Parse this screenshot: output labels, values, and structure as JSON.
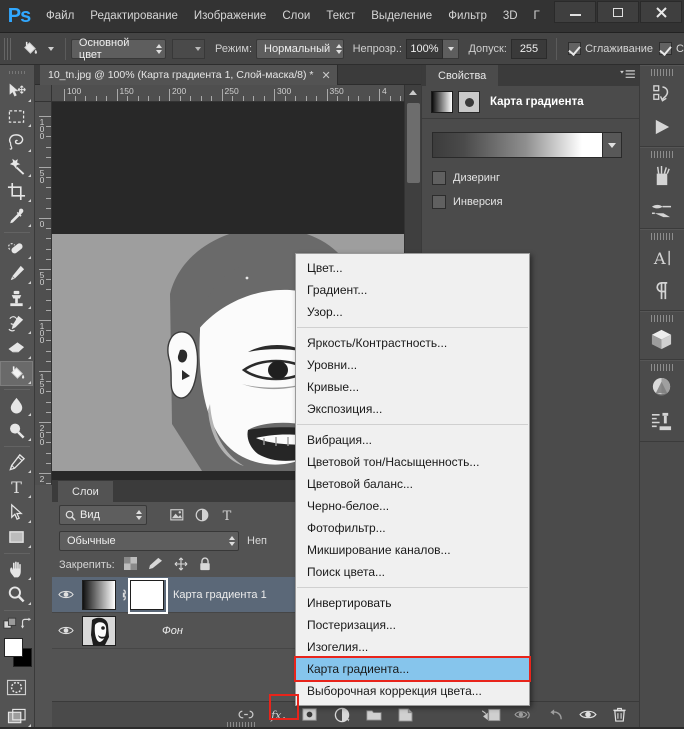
{
  "app": {
    "logo": "Ps"
  },
  "menubar": {
    "items": [
      "Файл",
      "Редактирование",
      "Изображение",
      "Слои",
      "Текст",
      "Выделение",
      "Фильтр",
      "3D",
      "Г"
    ],
    "window_controls": {
      "minimize": "–",
      "maximize": "□",
      "close": "✕"
    }
  },
  "options_bar": {
    "tool_icon": "paint-bucket-icon",
    "fill_source": "Основной цвет",
    "pattern_swatch": "",
    "mode_label": "Режим:",
    "mode_value": "Нормальный",
    "opacity_label": "Непрозр.:",
    "opacity_value": "100%",
    "tolerance_label": "Допуск:",
    "tolerance_value": "255",
    "antialias_label": "Сглаживание",
    "antialias_checked": true,
    "contiguous_label": "С",
    "contiguous_checked": true
  },
  "toolbar": {
    "tools": [
      {
        "name": "move-tool",
        "icon": "move"
      },
      {
        "name": "rectangular-marquee-tool",
        "icon": "marquee"
      },
      {
        "name": "lasso-tool",
        "icon": "lasso"
      },
      {
        "name": "magic-wand-tool",
        "icon": "wand"
      },
      {
        "name": "crop-tool",
        "icon": "crop"
      },
      {
        "name": "eyedropper-tool",
        "icon": "eyedropper"
      },
      {
        "name": "healing-brush-tool",
        "icon": "healing"
      },
      {
        "name": "brush-tool",
        "icon": "brush"
      },
      {
        "name": "clone-stamp-tool",
        "icon": "stamp"
      },
      {
        "name": "history-brush-tool",
        "icon": "history-brush"
      },
      {
        "name": "eraser-tool",
        "icon": "eraser"
      },
      {
        "name": "paint-bucket-tool",
        "icon": "bucket",
        "active": true
      },
      {
        "name": "blur-tool",
        "icon": "blur-drop"
      },
      {
        "name": "dodge-tool",
        "icon": "dodge"
      },
      {
        "name": "pen-tool",
        "icon": "pen"
      },
      {
        "name": "type-tool",
        "icon": "type-T"
      },
      {
        "name": "path-selection-tool",
        "icon": "arrow-pointer"
      },
      {
        "name": "rectangle-shape-tool",
        "icon": "rectangle"
      },
      {
        "name": "hand-tool",
        "icon": "hand"
      },
      {
        "name": "zoom-tool",
        "icon": "magnifier"
      }
    ],
    "foreground_color": "#ffffff",
    "background_color": "#000000",
    "quickmask_name": "quick-mask-toggle",
    "screenmode_name": "screen-mode-toggle"
  },
  "document": {
    "tab_title": "10_tn.jpg @ 100% (Карта градиента 1, Слой-маска/8) *",
    "close_label": "✕",
    "ruler_top_labels": [
      "100",
      "150",
      "200",
      "250",
      "300",
      "350",
      "4"
    ],
    "ruler_left_labels": [
      "100",
      "50",
      "0",
      "50",
      "100",
      "150",
      "200",
      "2"
    ]
  },
  "properties_panel": {
    "tab_label": "Свойства",
    "title": "Карта градиента",
    "dither_label": "Дизеринг",
    "dither_checked": false,
    "reverse_label": "Инверсия",
    "reverse_checked": false
  },
  "layers_panel": {
    "tab_label": "Слои",
    "filter_value": "Вид",
    "blend_mode": "Обычные",
    "opacity_label": "Неп",
    "lock_label": "Закрепить:",
    "rows": [
      {
        "name": "Карта градиента 1",
        "selected": true,
        "type": "adjustment-with-mask",
        "visible": true
      },
      {
        "name": "Фон",
        "selected": false,
        "type": "image",
        "visible": true,
        "italic": true
      }
    ],
    "footer_buttons": [
      "link-layers-button",
      "layer-style-button",
      "add-layer-mask-button",
      "new-adjustment-layer-button",
      "new-group-button",
      "new-layer-button"
    ]
  },
  "bottom_bar": {
    "buttons": [
      "add-mask-button",
      "visibility-toggle-button",
      "reset-button",
      "preview-eye-button",
      "delete-button"
    ]
  },
  "context_menu": {
    "groups": [
      [
        "Цвет...",
        "Градиент...",
        "Узор..."
      ],
      [
        "Яркость/Контрастность...",
        "Уровни...",
        "Кривые...",
        "Экспозиция..."
      ],
      [
        "Вибрация...",
        "Цветовой тон/Насыщенность...",
        "Цветовой баланс...",
        "Черно-белое...",
        "Фотофильтр...",
        "Микширование каналов...",
        "Поиск цвета..."
      ],
      [
        "Инвертировать",
        "Постеризация...",
        "Изогелия...",
        "Карта градиента...",
        "Выборочная коррекция цвета..."
      ]
    ],
    "highlighted": "Карта градиента...",
    "highlight_color": "#86c5ec",
    "highlight_outline_color": "#e8241b"
  },
  "dock": {
    "groups": [
      [
        "history-icon",
        "actions-play-icon"
      ],
      [
        "brush-presets-icon",
        "brush-settings-icon"
      ],
      [
        "character-icon",
        "paragraph-icon"
      ],
      [
        "3d-cube-icon"
      ],
      [
        "color-mixer-icon",
        "adjustments-icon"
      ]
    ]
  }
}
